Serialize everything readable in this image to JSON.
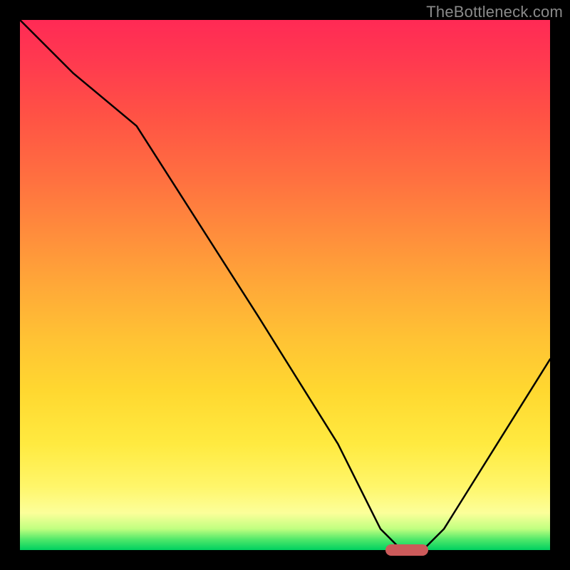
{
  "watermark": "TheBottleneck.com",
  "chart_data": {
    "type": "line",
    "title": "",
    "xlabel": "",
    "ylabel": "",
    "xlim": [
      0,
      100
    ],
    "ylim": [
      0,
      100
    ],
    "x": [
      0,
      10,
      22,
      45,
      60,
      68,
      72,
      76,
      80,
      90,
      100
    ],
    "values": [
      100,
      90,
      80,
      44,
      20,
      4,
      0,
      0,
      4,
      20,
      36
    ],
    "marker": {
      "x_start": 69,
      "x_end": 77,
      "y": 0
    },
    "colors": {
      "curve": "#000000",
      "marker": "#cc5a5a",
      "top": "#ff2a55",
      "bottom": "#00d060",
      "frame": "#000000"
    }
  }
}
